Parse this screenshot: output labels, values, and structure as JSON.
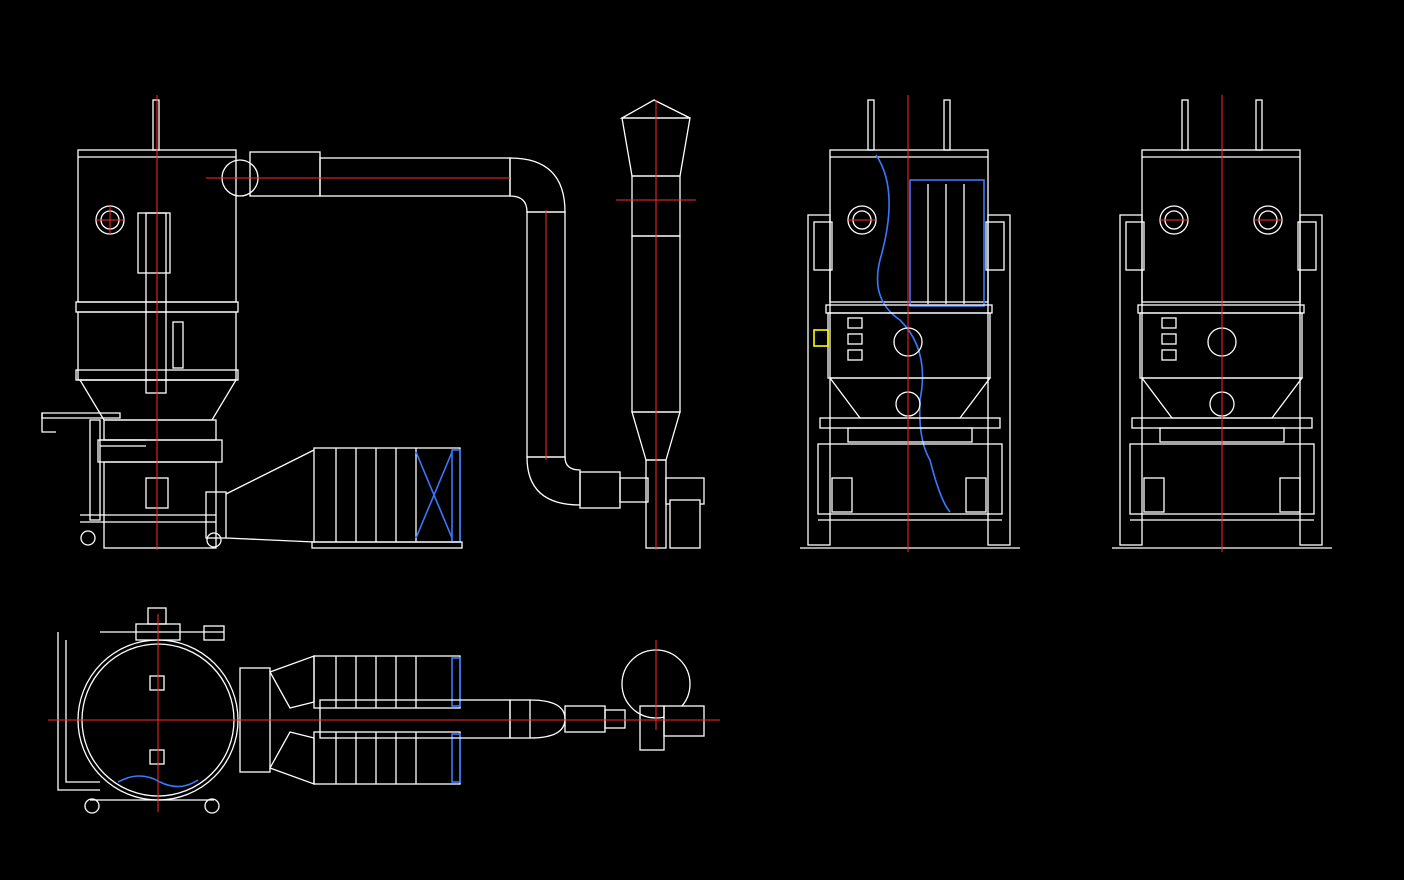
{
  "colors": {
    "background": "#000000",
    "outline": "#ffffff",
    "centerline": "#ff2a2a",
    "highlight": "#3a78ff",
    "marker": "#ffff00"
  },
  "views": [
    {
      "id": "side-elevation",
      "icon": "fluid-bed-dryer-side-view"
    },
    {
      "id": "front-elevation-section",
      "icon": "fluid-bed-dryer-front-section"
    },
    {
      "id": "front-elevation",
      "icon": "fluid-bed-dryer-front-view"
    },
    {
      "id": "plan-view",
      "icon": "fluid-bed-dryer-top-view"
    }
  ]
}
